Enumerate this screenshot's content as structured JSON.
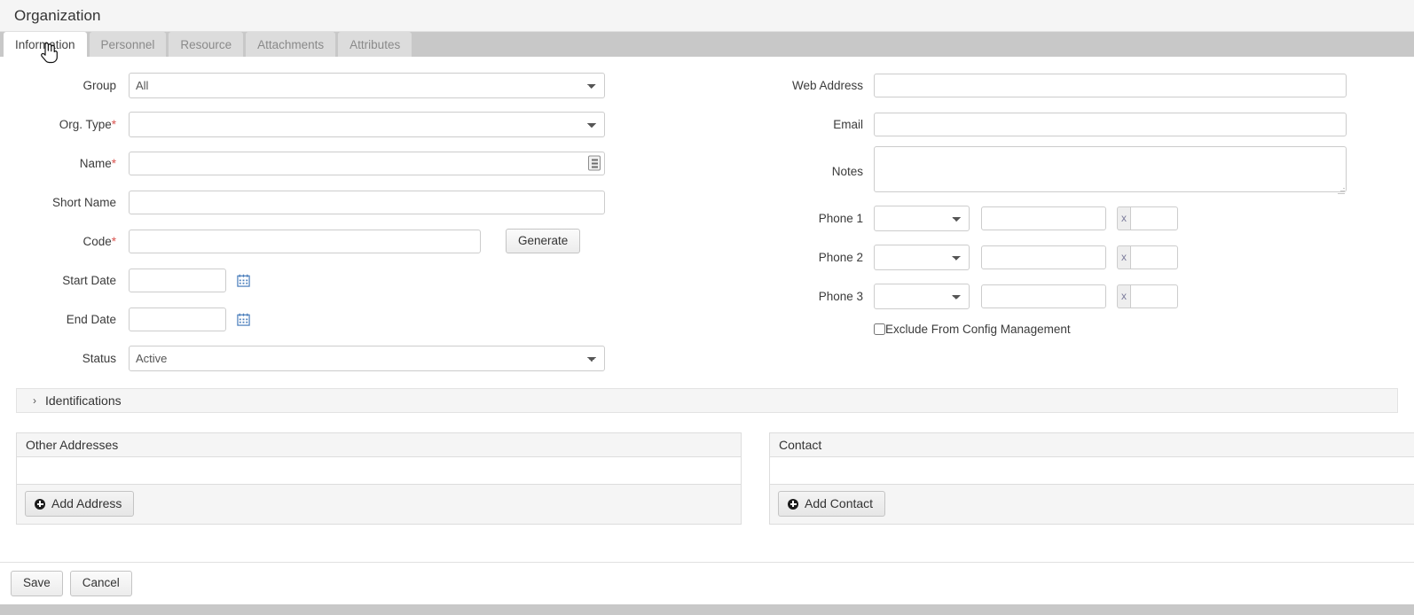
{
  "header": {
    "title": "Organization"
  },
  "tabs": [
    {
      "label": "Information",
      "active": true
    },
    {
      "label": "Personnel",
      "active": false
    },
    {
      "label": "Resource",
      "active": false
    },
    {
      "label": "Attachments",
      "active": false
    },
    {
      "label": "Attributes",
      "active": false
    }
  ],
  "form": {
    "left": {
      "group_label": "Group",
      "group_value": "All",
      "org_type_label": "Org. Type",
      "org_type_required": "*",
      "org_type_value": "",
      "name_label": "Name",
      "name_required": "*",
      "name_value": "",
      "name_icon": "list-picker-icon",
      "short_name_label": "Short Name",
      "short_name_value": "",
      "code_label": "Code",
      "code_required": "*",
      "code_value": "",
      "generate_label": "Generate",
      "start_date_label": "Start Date",
      "start_date_value": "",
      "end_date_label": "End Date",
      "end_date_value": "",
      "status_label": "Status",
      "status_value": "Active"
    },
    "right": {
      "web_address_label": "Web Address",
      "web_address_value": "",
      "email_label": "Email",
      "email_value": "",
      "notes_label": "Notes",
      "notes_value": "",
      "phone_ext_prefix": "x",
      "phones": [
        {
          "label": "Phone 1",
          "type_value": "",
          "number_value": "",
          "ext_value": ""
        },
        {
          "label": "Phone 2",
          "type_value": "",
          "number_value": "",
          "ext_value": ""
        },
        {
          "label": "Phone 3",
          "type_value": "",
          "number_value": "",
          "ext_value": ""
        }
      ],
      "exclude_checkbox_label": "Exclude From Config Management",
      "exclude_checked": false
    }
  },
  "identifications": {
    "title": "Identifications",
    "caret": "›",
    "expanded": false
  },
  "panels": {
    "addresses": {
      "title": "Other Addresses",
      "add_label": "Add Address",
      "rows": []
    },
    "contact": {
      "title": "Contact",
      "add_label": "Add Contact",
      "rows": []
    }
  },
  "footer": {
    "save_label": "Save",
    "cancel_label": "Cancel"
  },
  "colors": {
    "required_asterisk": "#d9534f",
    "tabbar_background": "#c8c8c8",
    "active_tab": "#ffffff",
    "inactive_tab": "#dcdcdc",
    "panel_header": "#f5f5f5",
    "calendar_icon": "#4a7ebb"
  }
}
